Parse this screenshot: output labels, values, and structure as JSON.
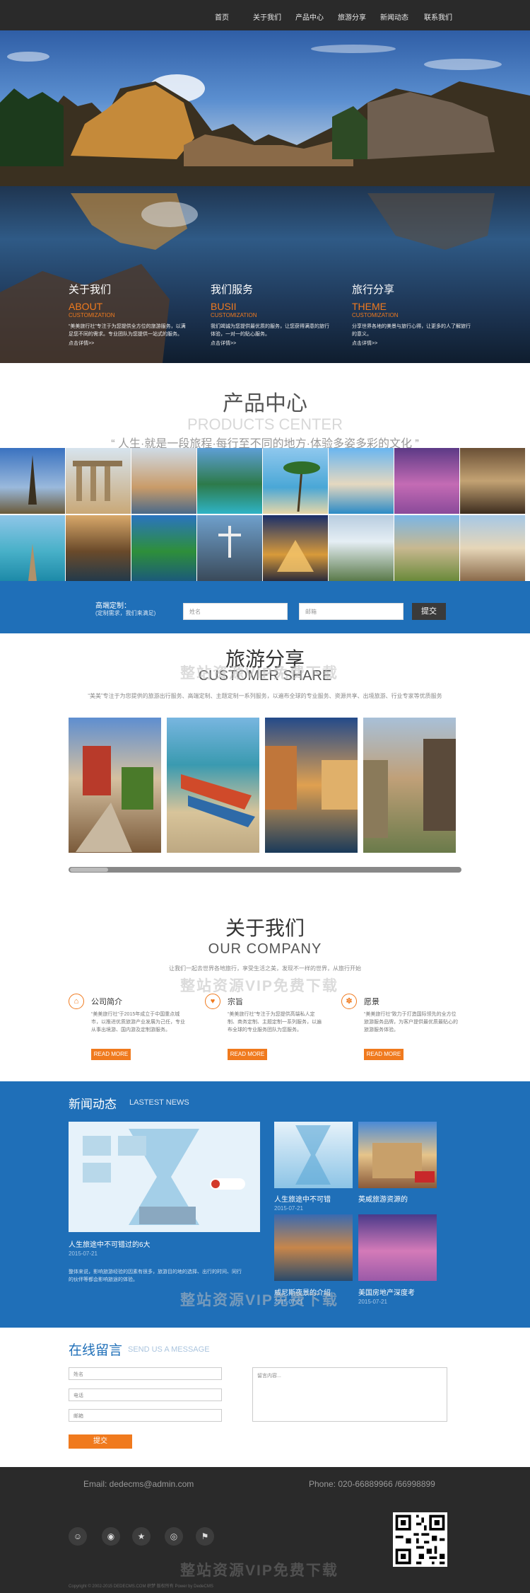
{
  "nav": {
    "items": [
      "首页",
      "关于我们",
      "产品中心",
      "旅游分享",
      "新闻动态",
      "联系我们"
    ]
  },
  "hero": {
    "columns": [
      {
        "title": "关于我们",
        "en": "ABOUT",
        "sub": "CUSTOMIZATION",
        "text": "“美美旅行社”专注于为您提供全方位的旅游服务，以满足您不同的需求。专业团队为您提供一站式的服务。",
        "more": "点击详情>>"
      },
      {
        "title": "我们服务",
        "en": "BUSII",
        "sub": "CUSTOMIZATION",
        "text": "我们竭诚为您提供最优质的服务，让您获得满意的旅行体验，一对一的贴心服务。",
        "more": "点击详情>>"
      },
      {
        "title": "旅行分享",
        "en": "THEME",
        "sub": "CUSTOMIZATION",
        "text": "分享世界各地的美景与旅行心得，让更多的人了解旅行的意义。",
        "more": "点击详情>>"
      }
    ]
  },
  "products": {
    "title": "产品中心",
    "title_en": "PRODUCTS CENTER",
    "quote": "“ 人生·就是一段旅程·每行至不同的地方·体验多姿多彩的文化 ”"
  },
  "custom_form": {
    "label": "高端定制：",
    "sublabel": "(定制需求，我们来满足)",
    "name_placeholder": "姓名",
    "email_placeholder": "邮箱",
    "submit": "提交"
  },
  "share": {
    "title": "旅游分享",
    "title_en": "CUSTOMER SHARE",
    "desc": "“美美”专注于为您提供的旅游出行服务、高端定制、主题定制一系列服务，以遍布全球的专业服务、资源共享、出境旅游、行业专家等优质服务"
  },
  "about": {
    "title": "关于我们",
    "title_en": "OUR COMPANY",
    "desc": "让我们一起去世界各地旅行，享受生活之美，发现不一样的世界，从旅行开始",
    "columns": [
      {
        "icon": "home-icon",
        "title": "公司简介",
        "text": "“美美旅行社”于2015年成立于中国重点城市，以推进优质旅游产业发展为己任，专业从事出境游、国内游及定制游服务。",
        "button": "READ MORE"
      },
      {
        "icon": "heart-icon",
        "title": "宗旨",
        "text": "“美美旅行社”专注于为您提供高端私人定制、商务定制、主题定制一系列服务，以遍布全球的专业服务团队为您服务。",
        "button": "READ MORE"
      },
      {
        "icon": "paw-icon",
        "title": "愿景",
        "text": "“美美旅行社”致力于打造国际领先的全方位旅游服务品牌，为客户提供最优质最贴心的旅游服务体验。",
        "button": "READ MORE"
      }
    ]
  },
  "news": {
    "title": "新闻动态",
    "title_en": "LASTEST NEWS",
    "big": {
      "caption": "人生旅途中不可错过的6大",
      "date": "2015-07-21",
      "text": "整体来说，影响旅游经验的因素有很多，旅游目的地的选择、出行的时间、同行的伙伴等都会影响旅途的体验。"
    },
    "items": [
      {
        "caption": "人生旅途中不可错",
        "date": "2015-07-21"
      },
      {
        "caption": "英威旅游资源的",
        "date": "2015-07-21"
      },
      {
        "caption": "威尼斯夜景的介绍",
        "date": "2015-07-21"
      },
      {
        "caption": "美国房地产深度考",
        "date": "2015-07-21"
      }
    ]
  },
  "message": {
    "title": "在线留言",
    "title_en": "SEND US A MESSAGE",
    "name_placeholder": "姓名",
    "phone_placeholder": "电话",
    "email_placeholder": "邮箱",
    "content_placeholder": "留言内容...",
    "submit": "提交"
  },
  "footer": {
    "email": "Email: dedecms@admin.com",
    "phone": "Phone: 020-66889966 /66998899",
    "copyright": "Copyright © 2002-2015 DEDECMS.COM 织梦 版权所有 Power by DedeCMS",
    "social": [
      "qq-icon",
      "weibo-icon",
      "star-icon",
      "wechat-icon",
      "tag-icon"
    ]
  },
  "watermark": "整站资源VIP免费下载",
  "colors": {
    "accent": "#f07a1e",
    "blue": "#1f6fb8",
    "dark": "#2a2a2a"
  }
}
